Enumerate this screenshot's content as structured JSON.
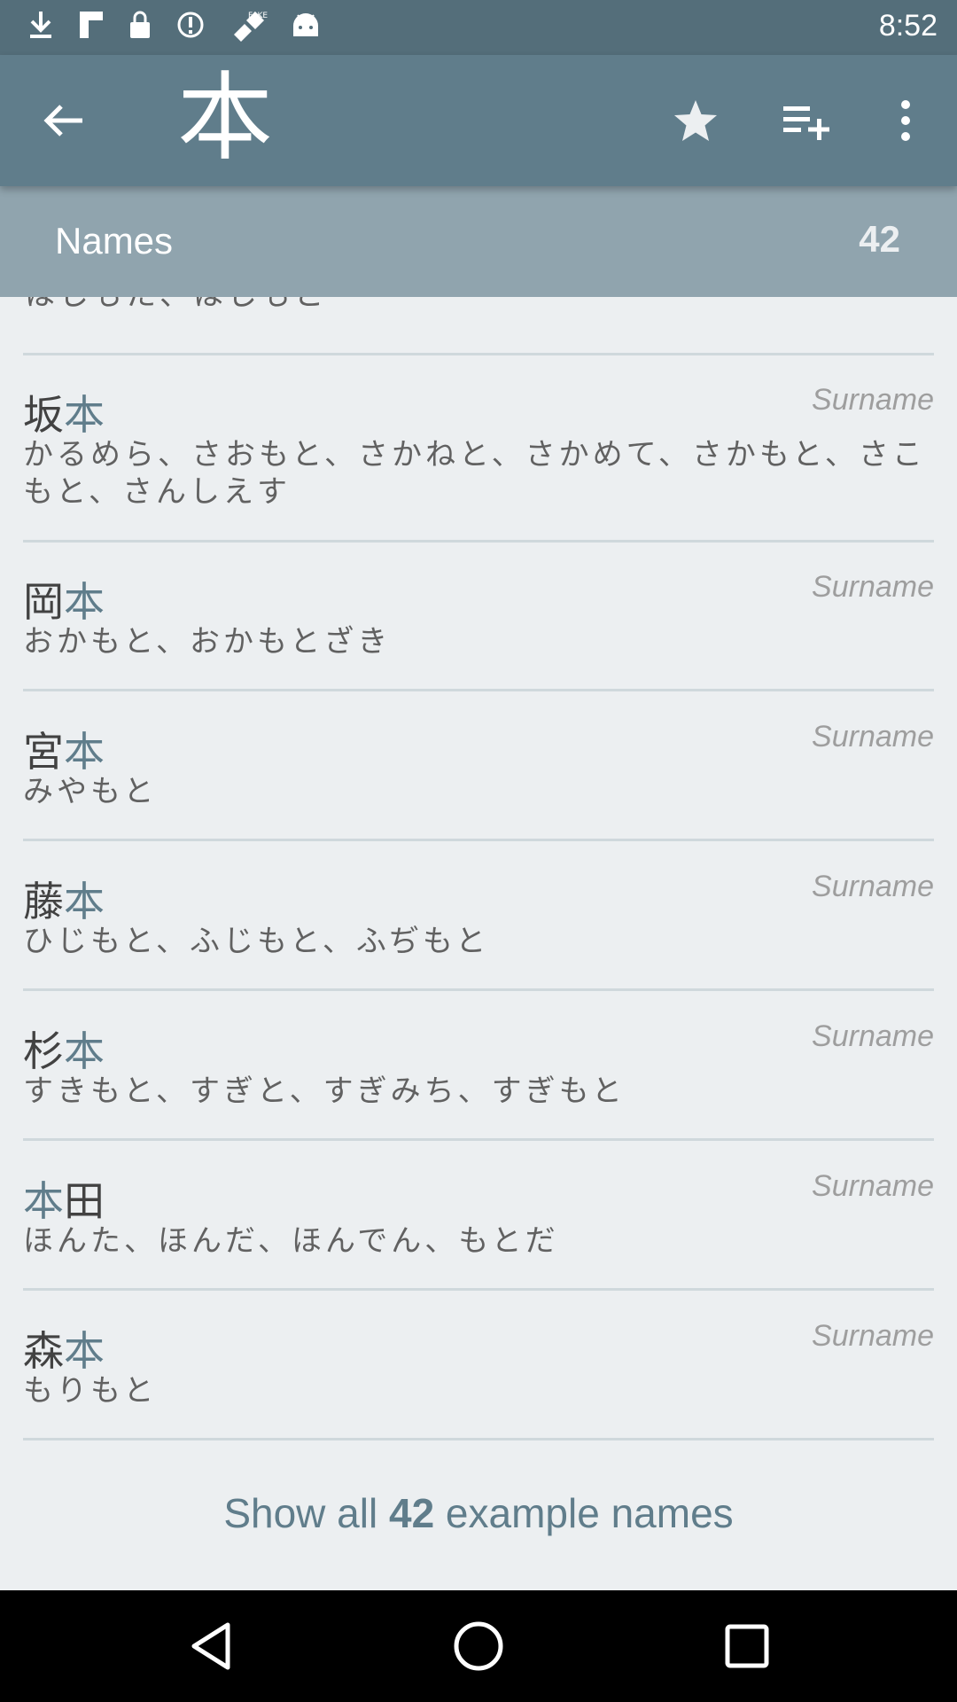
{
  "status_bar": {
    "time": "8:52",
    "icons": [
      "download-icon",
      "flipboard-icon",
      "lock-icon",
      "data-saver-icon",
      "fake-gps-icon",
      "android-icon"
    ]
  },
  "app_bar": {
    "title_kanji": "本",
    "back_icon": "arrow-back-icon",
    "actions": [
      "star-icon",
      "playlist-add-icon",
      "more-vert-icon"
    ]
  },
  "section": {
    "title": "Names",
    "count": "42"
  },
  "partial_item": {
    "reading": "はしもた、はしもと"
  },
  "items": [
    {
      "prefix": "坂",
      "highlight": "本",
      "suffix": "",
      "type": "Surname",
      "reading": "かるめら、さおもと、さかねと、さかめて、さかもと、さこもと、さんしえす"
    },
    {
      "prefix": "岡",
      "highlight": "本",
      "suffix": "",
      "type": "Surname",
      "reading": "おかもと、おかもとざき"
    },
    {
      "prefix": "宮",
      "highlight": "本",
      "suffix": "",
      "type": "Surname",
      "reading": "みやもと"
    },
    {
      "prefix": "藤",
      "highlight": "本",
      "suffix": "",
      "type": "Surname",
      "reading": "ひじもと、ふじもと、ふぢもと"
    },
    {
      "prefix": "杉",
      "highlight": "本",
      "suffix": "",
      "type": "Surname",
      "reading": "すきもと、すぎと、すぎみち、すぎもと"
    },
    {
      "prefix": "",
      "highlight": "本",
      "suffix": "田",
      "type": "Surname",
      "reading": "ほんた、ほんだ、ほんでん、もとだ"
    },
    {
      "prefix": "森",
      "highlight": "本",
      "suffix": "",
      "type": "Surname",
      "reading": "もりもと"
    }
  ],
  "show_all": {
    "pre": "Show all ",
    "count": "42",
    "post": " example names"
  },
  "nav_bar": {
    "buttons": [
      "back-triangle-icon",
      "home-circle-icon",
      "recents-square-icon"
    ]
  },
  "colors": {
    "status_bar": "#546e7a",
    "app_bar": "#607d8b",
    "section_header": "#90a4ae",
    "background": "#eceff1",
    "highlight": "#607d8b"
  }
}
